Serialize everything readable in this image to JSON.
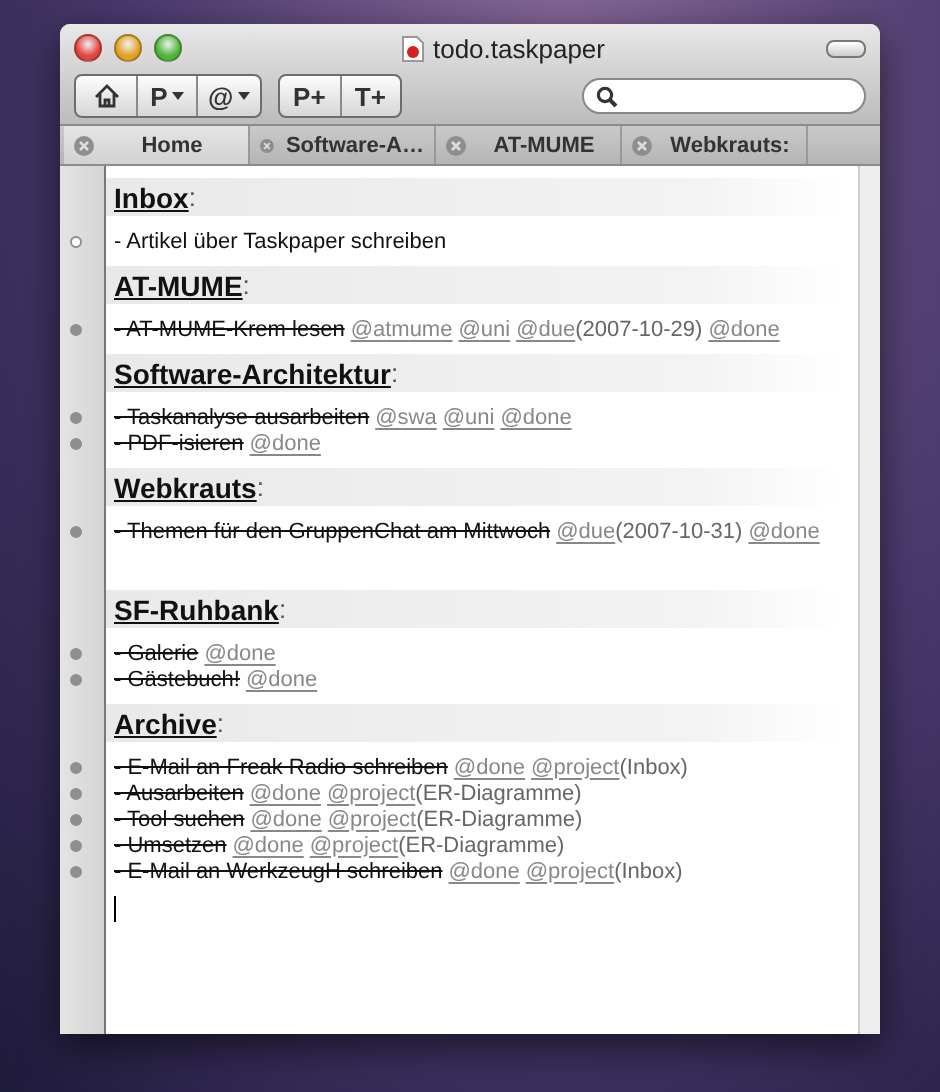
{
  "window": {
    "title": "todo.taskpaper"
  },
  "toolbar": {
    "groups": [
      [
        {
          "kind": "home"
        },
        {
          "kind": "menu",
          "label": "P"
        },
        {
          "kind": "menu",
          "label": "@"
        }
      ],
      [
        {
          "kind": "plain",
          "label": "P+"
        },
        {
          "kind": "plain",
          "label": "T+"
        }
      ]
    ]
  },
  "tabs": [
    {
      "label": "Home",
      "selected": true
    },
    {
      "label": "Software-A…",
      "selected": false
    },
    {
      "label": "AT-MUME",
      "selected": false
    },
    {
      "label": "Webkrauts:",
      "selected": false
    }
  ],
  "projects": [
    {
      "name": "Inbox",
      "colon": ":",
      "spacer_after": false,
      "tasks": [
        {
          "text": "- Artikel über Taskpaper schreiben",
          "done": false
        }
      ]
    },
    {
      "name": "AT-MUME",
      "colon": ":",
      "spacer_after": false,
      "tasks": [
        {
          "text": "- AT-MUME-Krem lesen",
          "done": true,
          "tags": [
            {
              "name": "@atmume"
            },
            {
              "name": "@uni"
            },
            {
              "name": "@due",
              "value": "(2007-10-29)"
            },
            {
              "name": "@done"
            }
          ]
        }
      ]
    },
    {
      "name": "Software-Architektur",
      "colon": ":",
      "spacer_after": false,
      "tasks": [
        {
          "text": "- Taskanalyse ausarbeiten",
          "done": true,
          "tags": [
            {
              "name": "@swa"
            },
            {
              "name": "@uni"
            },
            {
              "name": "@done"
            }
          ]
        },
        {
          "text": "- PDF-isieren",
          "done": true,
          "tags": [
            {
              "name": "@done"
            }
          ]
        }
      ]
    },
    {
      "name": "Webkrauts",
      "colon": ":",
      "spacer_after": true,
      "tasks": [
        {
          "text": "- Themen für den GruppenChat am Mittwoch",
          "done": true,
          "tags": [
            {
              "name": "@due",
              "value": "(2007-10-31)"
            },
            {
              "name": "@done"
            }
          ]
        }
      ]
    },
    {
      "name": "SF-Ruhbank",
      "colon": ":",
      "spacer_after": false,
      "tasks": [
        {
          "text": "- Galerie",
          "done": true,
          "tags": [
            {
              "name": "@done"
            }
          ]
        },
        {
          "text": "- Gästebuch!",
          "done": true,
          "tags": [
            {
              "name": "@done"
            }
          ]
        }
      ]
    },
    {
      "name": "Archive",
      "colon": ":",
      "spacer_after": false,
      "tasks": [
        {
          "text": "- E-Mail an Freak Radio schreiben",
          "done": true,
          "tags": [
            {
              "name": "@done"
            },
            {
              "name": "@project",
              "value": "(Inbox)"
            }
          ]
        },
        {
          "text": "- Ausarbeiten",
          "done": true,
          "tags": [
            {
              "name": "@done"
            },
            {
              "name": "@project",
              "value": "(ER-Diagramme)"
            }
          ]
        },
        {
          "text": "- Tool suchen",
          "done": true,
          "tags": [
            {
              "name": "@done"
            },
            {
              "name": "@project",
              "value": "(ER-Diagramme)"
            }
          ]
        },
        {
          "text": "- Umsetzen",
          "done": true,
          "tags": [
            {
              "name": "@done"
            },
            {
              "name": "@project",
              "value": "(ER-Diagramme)"
            }
          ]
        },
        {
          "text": "- E-Mail an WerkzeugH schreiben",
          "done": true,
          "tags": [
            {
              "name": "@done"
            },
            {
              "name": "@project",
              "value": "(Inbox)"
            }
          ]
        }
      ]
    }
  ]
}
